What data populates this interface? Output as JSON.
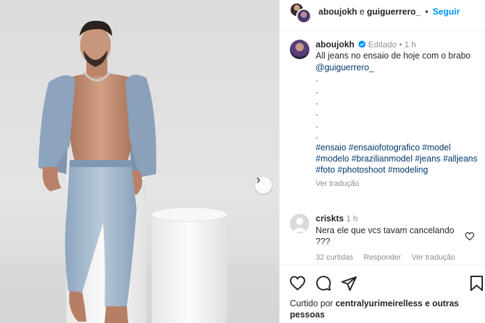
{
  "header": {
    "user1": "aboujokh",
    "connector": "e",
    "user2": "guiguerrero_",
    "dot": "•",
    "follow_label": "Seguir"
  },
  "caption": {
    "username": "aboujokh",
    "edited_label": "Editado",
    "dot": "•",
    "time": "1 h",
    "text_part1": "All jeans no ensaio de hoje com o brabo ",
    "mention": "@guiguerrero_",
    "dots": [
      ".",
      ".",
      ".",
      ".",
      ".",
      "."
    ],
    "hashtags": "#ensaio #ensaiofotografico #model #modelo #brazilianmodel #jeans #alljeans #foto #photoshoot #modeling",
    "translate_label": "Ver tradução"
  },
  "comment": {
    "username": "criskts",
    "time": "1 h",
    "text": "Nera ele que vcs tavam cancelando ???",
    "likes_label": "32 curtidas",
    "reply_label": "Responder",
    "translate_label": "Ver tradução"
  },
  "likes": {
    "prefix": "Curtido por ",
    "user": "centralyurimeirelless",
    "suffix": " e outras pessoas"
  },
  "icons": {
    "like": "heart-icon",
    "comment": "comment-icon",
    "share": "share-icon",
    "save": "bookmark-icon",
    "next": "chevron-right-icon",
    "verified": "verified-badge-icon"
  },
  "colors": {
    "accent": "#0095f6",
    "link": "#00376b",
    "muted": "#8e8e8e",
    "verified": "#0095f6"
  }
}
